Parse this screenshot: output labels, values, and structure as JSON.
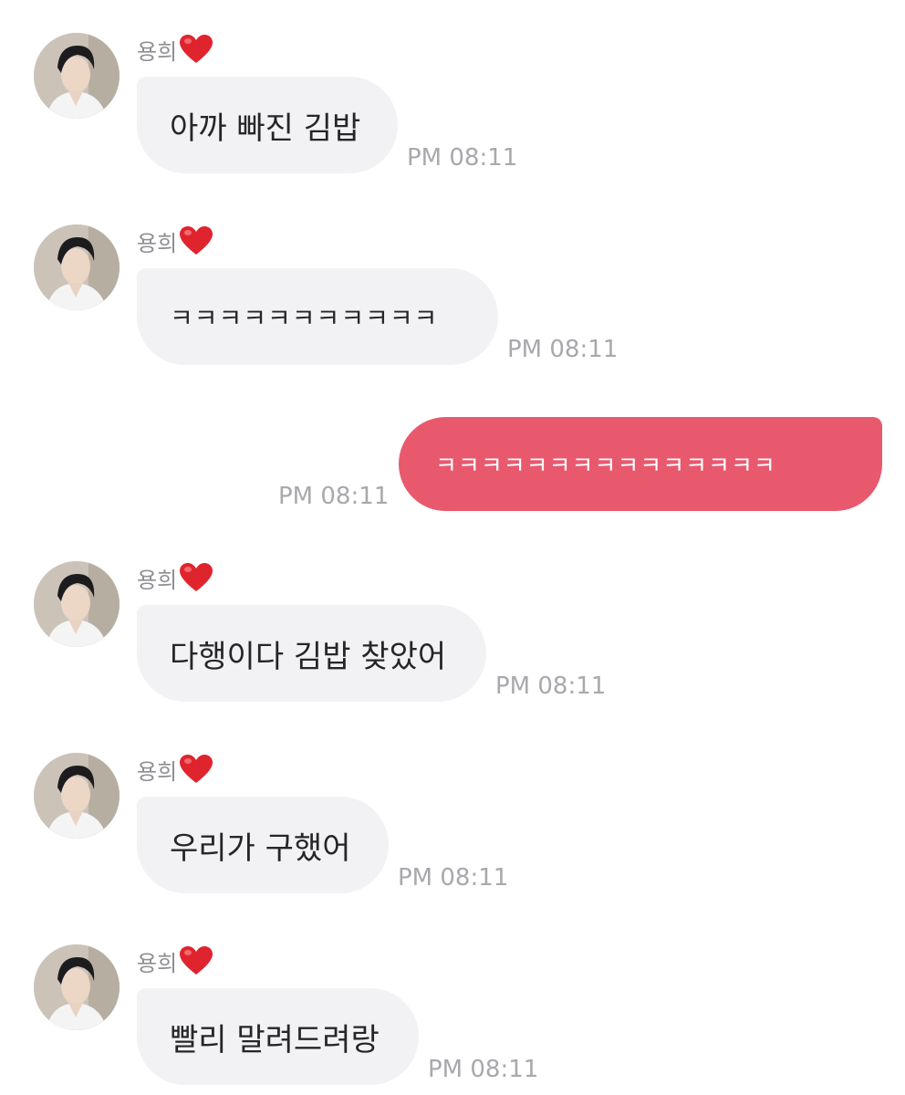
{
  "contact": {
    "name": "용희",
    "heart_icon": "red-heart-emoji",
    "avatar_icon": "profile-photo"
  },
  "colors": {
    "incoming_bubble": "#f2f2f5",
    "outgoing_bubble": "#e8596e",
    "timestamp": "#a8a8ad",
    "sender_name": "#8e8e93"
  },
  "messages": [
    {
      "direction": "incoming",
      "text": "아까 빠진 김밥",
      "time": "PM 08:11"
    },
    {
      "direction": "incoming",
      "text": "ㅋㅋㅋㅋㅋㅋㅋㅋㅋㅋㅋ",
      "time": "PM 08:11"
    },
    {
      "direction": "outgoing",
      "text": "ㅋㅋㅋㅋㅋㅋㅋㅋㅋㅋㅋㅋㅋㅋㅋ",
      "time": "PM 08:11"
    },
    {
      "direction": "incoming",
      "text": "다행이다 김밥 찾았어",
      "time": "PM 08:11"
    },
    {
      "direction": "incoming",
      "text": "우리가 구했어",
      "time": "PM 08:11"
    },
    {
      "direction": "incoming",
      "text": "빨리 말려드려랑",
      "time": "PM 08:11"
    }
  ]
}
